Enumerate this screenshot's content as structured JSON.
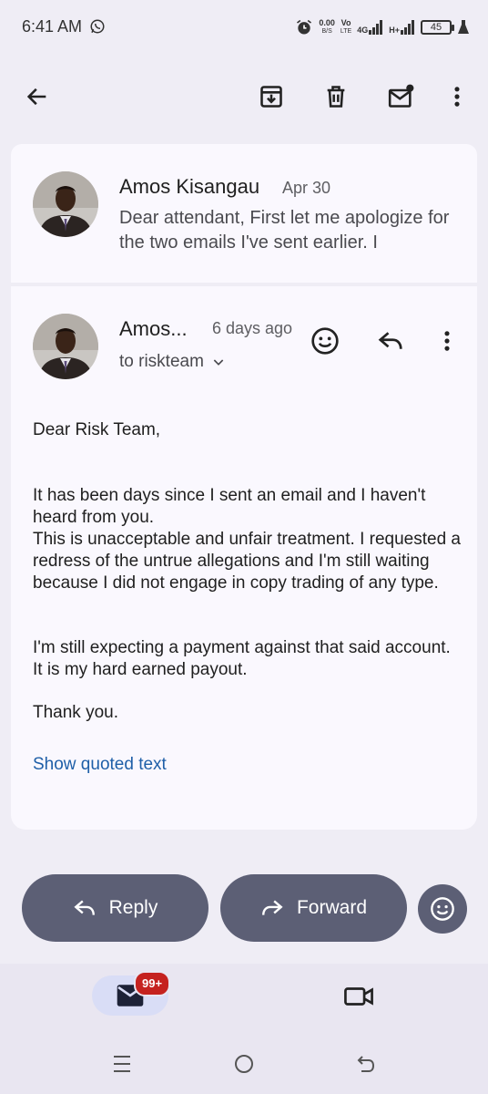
{
  "status_bar": {
    "time": "6:41 AM",
    "net_speed": "0.00",
    "net_unit": "B/S",
    "volte_top": "Vo",
    "volte_bottom": "LTE",
    "signal1": "4G",
    "signal2": "H+",
    "battery": "45"
  },
  "toolbar": {
    "icons": [
      "back-arrow-icon",
      "archive-icon",
      "delete-icon",
      "mark-unread-icon",
      "more-vert-icon"
    ]
  },
  "collapsed_message": {
    "sender": "Amos Kisangau",
    "date": "Apr 30",
    "snippet": "Dear attendant, First let me apologize for the two emails I've sent earlier. I"
  },
  "expanded_message": {
    "sender": "Amos...",
    "date": "6 days ago",
    "to": "to riskteam",
    "greeting": "Dear Risk Team,",
    "paragraph1": "It has been days since I sent an email and I haven't heard from you.",
    "paragraph2": "This is unacceptable and unfair treatment. I requested a redress of the untrue allegations and I'm still waiting because I did not engage in copy trading of any type.",
    "paragraph3": "I'm still expecting a payment against that said account. It is my hard earned payout.",
    "closing": "Thank you.",
    "show_quoted": "Show quoted text"
  },
  "actions": {
    "reply": "Reply",
    "forward": "Forward"
  },
  "bottom_nav": {
    "mail_badge": "99+"
  },
  "colors": {
    "background": "#efedf5",
    "card": "#faf8fe",
    "action_pill": "#5c5f75",
    "link": "#1f5fa8",
    "badge": "#c5221f"
  }
}
